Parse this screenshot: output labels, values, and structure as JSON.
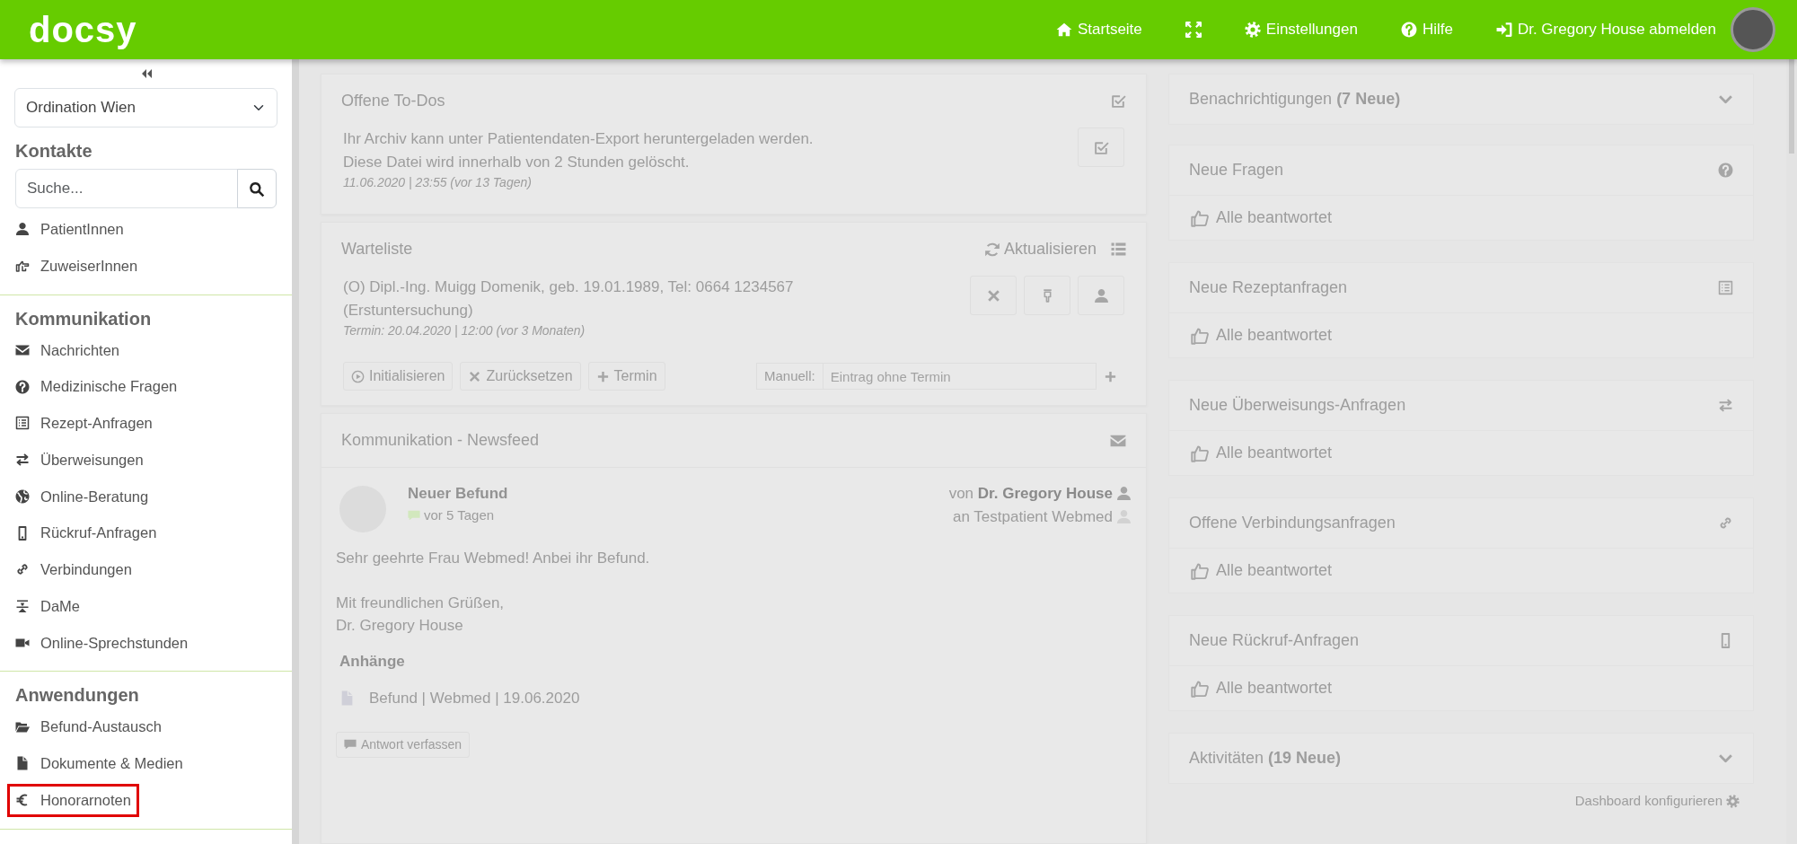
{
  "navbar": {
    "logo": "docsy",
    "links": [
      {
        "kind": "home",
        "label": "Startseite"
      },
      {
        "kind": "fullscreen"
      },
      {
        "kind": "gear",
        "label": "Einstellungen"
      },
      {
        "kind": "question",
        "label": "Hilfe"
      },
      {
        "kind": "sign-in",
        "label": "Dr. Gregory House abmelden"
      }
    ]
  },
  "sidebar": {
    "location_select": {
      "value": "Ordination Wien"
    },
    "sections": [
      {
        "title": "Kontakte",
        "search": {
          "placeholder": "Suche..."
        },
        "items": [
          {
            "kind": "user",
            "label": "PatientInnen",
            "highlighted": false
          },
          {
            "kind": "hand-point",
            "label": "ZuweiserInnen",
            "highlighted": false
          }
        ]
      },
      {
        "title": "Kommunikation",
        "items": [
          {
            "kind": "envelope",
            "label": "Nachrichten",
            "highlighted": false
          },
          {
            "kind": "question",
            "label": "Medizinische Fragen",
            "highlighted": false
          },
          {
            "kind": "list",
            "label": "Rezept-Anfragen",
            "highlighted": false
          },
          {
            "kind": "exchange",
            "label": "Überweisungen",
            "highlighted": false
          },
          {
            "kind": "globe",
            "label": "Online-Beratung",
            "highlighted": false
          },
          {
            "kind": "mobile",
            "label": "Rückruf-Anfragen",
            "highlighted": false
          },
          {
            "kind": "link",
            "label": "Verbindungen",
            "highlighted": false
          },
          {
            "kind": "dame",
            "label": "DaMe",
            "highlighted": false
          },
          {
            "kind": "video",
            "label": "Online-Sprechstunden",
            "highlighted": false
          }
        ]
      },
      {
        "title": "Anwendungen",
        "items": [
          {
            "kind": "folder",
            "label": "Befund-Austausch",
            "highlighted": false
          },
          {
            "kind": "file",
            "label": "Dokumente & Medien",
            "highlighted": false
          },
          {
            "kind": "euro",
            "label": "Honorarnoten",
            "highlighted": true
          }
        ]
      }
    ]
  },
  "todos": {
    "title": "Offene To-Dos",
    "items": [
      {
        "lines": [
          "Ihr Archiv kann unter Patientendaten-Export heruntergeladen werden.",
          "Diese Datei wird innerhalb von 2 Stunden gelöscht."
        ],
        "meta": "11.06.2020 | 23:55 (vor 13 Tagen)"
      }
    ]
  },
  "waitlist": {
    "title": "Warteliste",
    "refresh_label": "Aktualisieren",
    "entries": [
      {
        "lines": [
          "(O) Dipl.-Ing. Muigg Domenik, geb. 19.01.1989, Tel: 0664 1234567",
          "(Erstuntersuchung)"
        ],
        "meta": "Termin: 20.04.2020 | 12:00 (vor 3 Monaten)"
      }
    ],
    "actions": [
      {
        "kind": "play",
        "label": "Initialisieren"
      },
      {
        "kind": "times",
        "label": "Zurücksetzen"
      },
      {
        "kind": "plus",
        "label": "Termin"
      }
    ],
    "manual": {
      "label": "Manuell:",
      "placeholder": "Eintrag ohne Termin"
    }
  },
  "newsfeed": {
    "title": "Kommunikation - Newsfeed",
    "posts": [
      {
        "title": "Neuer Befund",
        "time": "vor 5 Tagen",
        "from": "von **Dr. Gregory House**",
        "to": "an Testpatient Webmed",
        "body": [
          [
            "Sehr geehrte Frau Webmed! Anbei ihr Befund."
          ],
          [
            "Mit freundlichen Grüßen,",
            "Dr. Gregory House"
          ]
        ],
        "attachments_title": "Anhänge",
        "attachments": [
          "Befund | Webmed | 19.06.2020"
        ],
        "reply_label": "Antwort verfassen"
      }
    ]
  },
  "notifications": {
    "title": "Benachrichtigungen",
    "count": "(7 Neue)",
    "groups": [
      {
        "title": "Neue Fragen",
        "kind": "question",
        "status": "Alle beantwortet"
      },
      {
        "title": "Neue Rezeptanfragen",
        "kind": "list",
        "status": "Alle beantwortet"
      },
      {
        "title": "Neue Überweisungs-Anfragen",
        "kind": "exchange",
        "status": "Alle beantwortet"
      },
      {
        "title": "Offene Verbindungsanfragen",
        "kind": "link",
        "status": "Alle beantwortet"
      },
      {
        "title": "Neue Rückruf-Anfragen",
        "kind": "mobile",
        "status": "Alle beantwortet"
      }
    ]
  },
  "activities": {
    "title": "Aktivitäten",
    "count": "(19 Neue)"
  },
  "configure_label": "Dashboard konfigurieren"
}
